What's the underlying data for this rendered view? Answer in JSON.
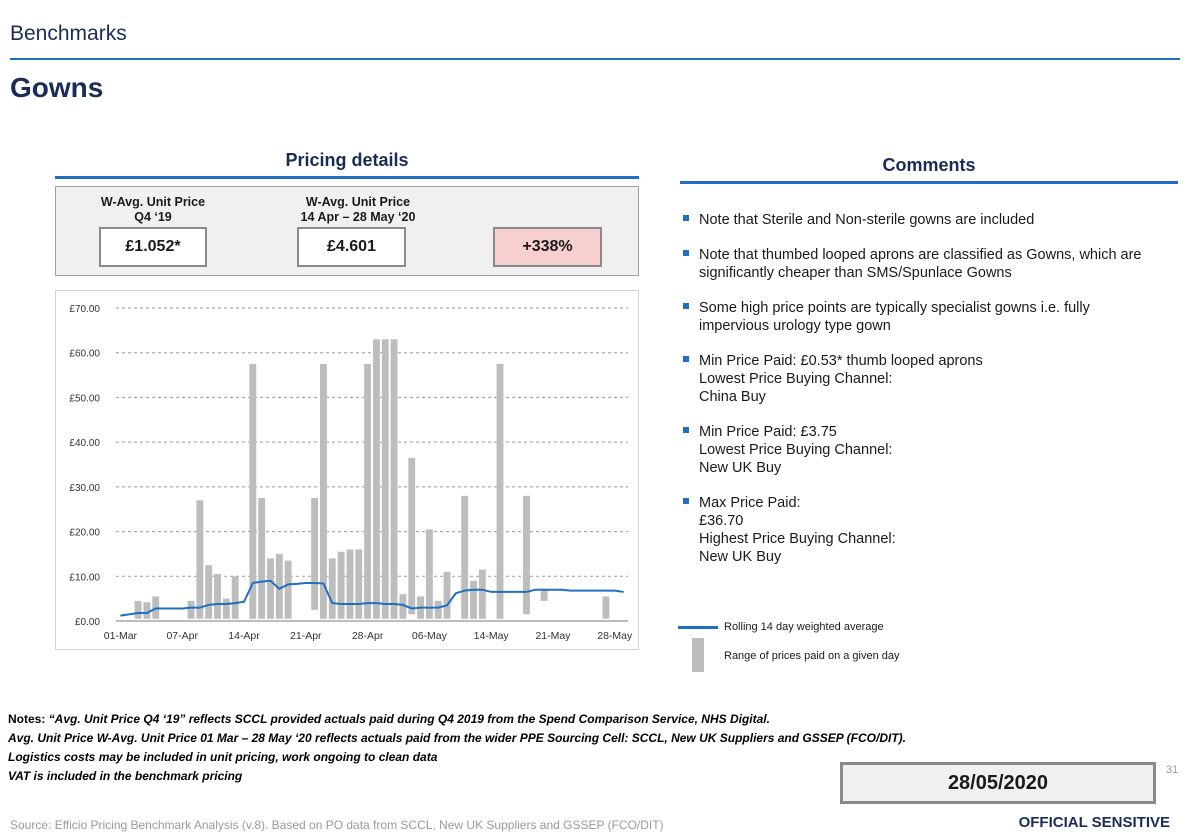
{
  "header": {
    "section": "Benchmarks",
    "title": "Gowns"
  },
  "pricing": {
    "heading": "Pricing details",
    "kpis": [
      {
        "header_line1": "W-Avg. Unit Price",
        "header_line2": "Q4 ‘19",
        "value": "£1.052*"
      },
      {
        "header_line1": "W-Avg. Unit Price",
        "header_line2": "14 Apr – 28 May ‘20",
        "value": "£4.601"
      },
      {
        "header_line1": "",
        "header_line2": "",
        "value": "+338%"
      }
    ]
  },
  "chart_data": {
    "type": "bar",
    "title": "",
    "xlabel": "",
    "ylabel": "",
    "ylim": [
      0,
      70
    ],
    "yticks": [
      "£0.00",
      "£10.00",
      "£20.00",
      "£30.00",
      "£40.00",
      "£50.00",
      "£60.00",
      "£70.00"
    ],
    "xticks": [
      "01-Mar",
      "07-Apr",
      "14-Apr",
      "21-Apr",
      "28-Apr",
      "06-May",
      "14-May",
      "21-May",
      "28-May"
    ],
    "grid": true,
    "range_bars": [
      {
        "day": 2,
        "low": 0.5,
        "high": 4.5
      },
      {
        "day": 3,
        "low": 0.5,
        "high": 4.2
      },
      {
        "day": 4,
        "low": 0.5,
        "high": 5.5
      },
      {
        "day": 8,
        "low": 0.5,
        "high": 4.5
      },
      {
        "day": 9,
        "low": 0.5,
        "high": 27
      },
      {
        "day": 10,
        "low": 0.5,
        "high": 12.5
      },
      {
        "day": 11,
        "low": 0.5,
        "high": 10.5
      },
      {
        "day": 12,
        "low": 0.5,
        "high": 5
      },
      {
        "day": 13,
        "low": 0.5,
        "high": 10
      },
      {
        "day": 15,
        "low": 0.5,
        "high": 57.5
      },
      {
        "day": 16,
        "low": 0.5,
        "high": 27.5
      },
      {
        "day": 17,
        "low": 0.5,
        "high": 14
      },
      {
        "day": 18,
        "low": 0.5,
        "high": 15
      },
      {
        "day": 19,
        "low": 0.5,
        "high": 13.5
      },
      {
        "day": 22,
        "low": 2.5,
        "high": 27.5
      },
      {
        "day": 23,
        "low": 0.5,
        "high": 57.5
      },
      {
        "day": 24,
        "low": 0.5,
        "high": 14
      },
      {
        "day": 25,
        "low": 0.5,
        "high": 15.5
      },
      {
        "day": 26,
        "low": 0.5,
        "high": 16
      },
      {
        "day": 27,
        "low": 0.5,
        "high": 16
      },
      {
        "day": 28,
        "low": 0.5,
        "high": 57.5
      },
      {
        "day": 29,
        "low": 0.5,
        "high": 63
      },
      {
        "day": 30,
        "low": 0.5,
        "high": 63
      },
      {
        "day": 31,
        "low": 0.5,
        "high": 63
      },
      {
        "day": 32,
        "low": 0.5,
        "high": 6
      },
      {
        "day": 33,
        "low": 1.5,
        "high": 36.5
      },
      {
        "day": 34,
        "low": 0.5,
        "high": 5.5
      },
      {
        "day": 35,
        "low": 0.5,
        "high": 20.5
      },
      {
        "day": 36,
        "low": 0.5,
        "high": 4.5
      },
      {
        "day": 37,
        "low": 0.5,
        "high": 11
      },
      {
        "day": 39,
        "low": 0.5,
        "high": 28
      },
      {
        "day": 40,
        "low": 0.5,
        "high": 9
      },
      {
        "day": 41,
        "low": 0.5,
        "high": 11.5
      },
      {
        "day": 43,
        "low": 0.5,
        "high": 57.5
      },
      {
        "day": 46,
        "low": 1.5,
        "high": 28
      },
      {
        "day": 48,
        "low": 4.5,
        "high": 7
      },
      {
        "day": 55,
        "low": 0.5,
        "high": 5.5
      }
    ],
    "series": [
      {
        "name": "Rolling 14 day weighted average",
        "days": [
          0,
          2,
          3,
          4,
          5,
          6,
          7,
          8,
          9,
          10,
          11,
          12,
          13,
          14,
          15,
          16,
          17,
          18,
          19,
          20,
          21,
          22,
          23,
          24,
          25,
          26,
          27,
          28,
          29,
          30,
          31,
          32,
          33,
          34,
          35,
          36,
          37,
          38,
          39,
          40,
          41,
          42,
          43,
          44,
          45,
          46,
          47,
          48,
          49,
          50,
          51,
          52,
          53,
          54,
          55,
          56,
          57
        ],
        "values": [
          1.2,
          1.8,
          1.8,
          2.8,
          2.8,
          2.8,
          2.8,
          3,
          3,
          3.6,
          3.8,
          3.8,
          4,
          4.3,
          8.5,
          8.8,
          9,
          7.2,
          8.2,
          8.3,
          8.5,
          8.5,
          8.4,
          4,
          3.8,
          3.8,
          3.8,
          4,
          4,
          3.8,
          3.8,
          3.6,
          2.8,
          3,
          3,
          3,
          3.5,
          6.2,
          6.8,
          7,
          7,
          6.5,
          6.5,
          6.5,
          6.5,
          6.5,
          7,
          7,
          7,
          7,
          6.8,
          6.8,
          6.8,
          6.8,
          6.8,
          6.8,
          6.5,
          4.8,
          4.8,
          4.8
        ]
      }
    ],
    "legend": [
      {
        "label": "Rolling 14 day weighted average"
      },
      {
        "label": "Range of prices paid on a given day"
      }
    ]
  },
  "comments": {
    "heading": "Comments",
    "items": [
      {
        "lines": [
          "Note that Sterile and Non-sterile gowns are included"
        ]
      },
      {
        "lines": [
          "Note that thumbed looped aprons are classified as Gowns, which are",
          "significantly cheaper than SMS/Spunlace Gowns"
        ]
      },
      {
        "lines": [
          "Some high price points are typically specialist gowns i.e. fully",
          "impervious urology type gown"
        ]
      },
      {
        "lines": [
          "Min Price Paid: £0.53* thumb looped aprons",
          "Lowest Price Buying Channel:",
          "China Buy"
        ]
      },
      {
        "lines": [
          "Min Price Paid: £3.75",
          "Lowest Price Buying Channel:",
          "New UK Buy"
        ]
      },
      {
        "lines": [
          "Max Price Paid:",
          "£36.70",
          "Highest Price Buying Channel:",
          "New UK Buy"
        ]
      }
    ]
  },
  "notes": {
    "prefix": "Notes: ",
    "line1": "“Avg. Unit Price Q4 ‘19” reflects SCCL provided actuals paid during Q4 2019 from the Spend Comparison Service, NHS Digital.",
    "line2": "Avg. Unit Price W-Avg. Unit Price 01 Mar – 28 May ‘20 reflects actuals paid from the wider PPE Sourcing Cell: SCCL, New UK Suppliers and GSSEP (FCO/DIT).",
    "line3": "Logistics costs may be included in unit pricing, work ongoing to clean data",
    "line4": "VAT is included in the benchmark pricing"
  },
  "footer": {
    "page_number": "31",
    "date": "28/05/2020",
    "source": "Source: Efficio Pricing Benchmark Analysis (v.8). Based on PO data from SCCL, New UK Suppliers and GSSEP (FCO/DIT)",
    "classification": "OFFICIAL SENSITIVE"
  },
  "colors": {
    "accent": "#1f6fc2",
    "title": "#1a2b5a",
    "bar": "#bdbdbd",
    "change_fill": "#f8cfcf"
  }
}
